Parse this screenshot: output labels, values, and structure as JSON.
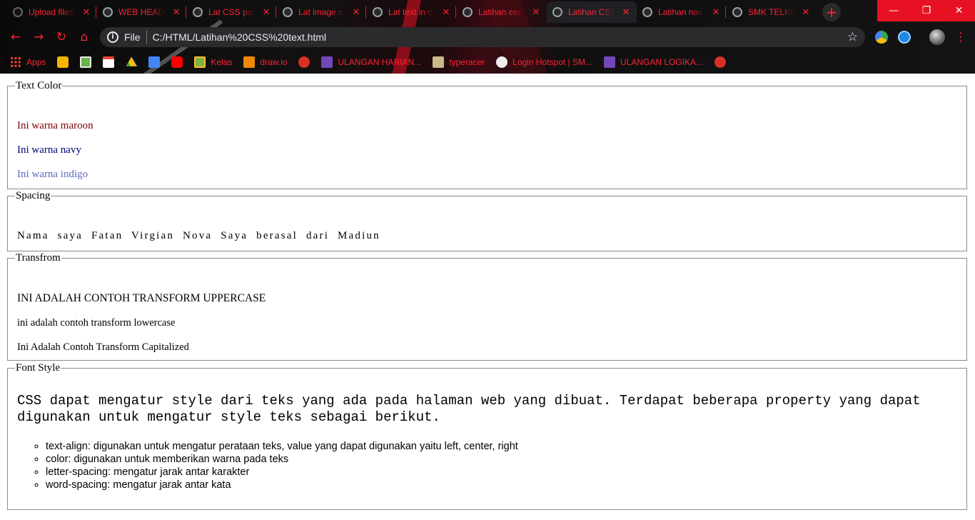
{
  "browser": {
    "tabs": [
      {
        "title": "Upload files to GitHub",
        "active": false
      },
      {
        "title": "WEB HEADER",
        "active": false
      },
      {
        "title": "Lat CSS position",
        "active": false
      },
      {
        "title": "Lat image css",
        "active": false
      },
      {
        "title": "Lat text in css",
        "active": false
      },
      {
        "title": "Latihan css",
        "active": false
      },
      {
        "title": "Latihan CSS",
        "active": true
      },
      {
        "title": "Latihan nav",
        "active": false
      },
      {
        "title": "SMK TELKOM",
        "active": false
      }
    ],
    "tab_close_glyph": "✕",
    "new_tab_glyph": "+",
    "window_controls": {
      "minimize": "—",
      "maximize": "❐",
      "close": "✕"
    },
    "nav": {
      "back": "←",
      "forward": "→",
      "reload": "↻",
      "home": "⌂"
    },
    "omnibox": {
      "info_glyph": "i",
      "scheme_label": "File",
      "url": "C:/HTML/Latihan%20CSS%20text.html",
      "star_glyph": "☆"
    },
    "menu_glyph": "⋮",
    "bookmarks": [
      {
        "label": "Apps",
        "icon": "apps-grid-icon"
      },
      {
        "label": "",
        "icon": "keep-icon"
      },
      {
        "label": "",
        "icon": "photos-icon"
      },
      {
        "label": "",
        "icon": "gmail-icon"
      },
      {
        "label": "",
        "icon": "drive-icon"
      },
      {
        "label": "",
        "icon": "docs-icon"
      },
      {
        "label": "",
        "icon": "youtube-icon"
      },
      {
        "label": "Kelas",
        "icon": "classroom-icon"
      },
      {
        "label": "draw.io",
        "icon": "drawio-icon"
      },
      {
        "label": "",
        "icon": "globe-icon"
      },
      {
        "label": "ULANGAN HARIAN...",
        "icon": "forms-icon"
      },
      {
        "label": "typeracer",
        "icon": "typeracer-icon"
      },
      {
        "label": "Login Hotspot | SM...",
        "icon": "hotspot-icon"
      },
      {
        "label": "ULANGAN LOGIKA...",
        "icon": "forms-icon"
      },
      {
        "label": "",
        "icon": "globe-icon"
      }
    ],
    "accent_color": "#ff2233"
  },
  "page": {
    "text_color": {
      "legend": "Text Color",
      "lines": [
        "Ini warna maroon",
        "Ini warna navy",
        "Ini warna indigo"
      ],
      "colors": [
        "#800000",
        "#000080",
        "#5c6bc0"
      ]
    },
    "spacing": {
      "legend": "Spacing",
      "text": "Nama saya Fatan Virgian Nova Saya berasal dari Madiun"
    },
    "transform": {
      "legend": "Transfrom",
      "uppercase": "INI ADALAH CONTOH TRANSFORM UPPERCASE",
      "lowercase": "ini adalah contoh transform lowercase",
      "capitalized": "Ini Adalah Contoh Transform Capitalized"
    },
    "font_style": {
      "legend": "Font Style",
      "paragraph": "CSS dapat mengatur style dari teks yang ada pada halaman web yang dibuat. Terdapat beberapa property yang dapat digunakan untuk mengatur style teks sebagai berikut.",
      "items": [
        "text-align: digunakan untuk mengatur perataan teks, value yang dapat digunakan yaitu left, center, right",
        "color: digunakan untuk memberikan warna pada teks",
        "letter-spacing: mengatur jarak antar karakter",
        "word-spacing: mengatur jarak antar kata"
      ]
    }
  }
}
